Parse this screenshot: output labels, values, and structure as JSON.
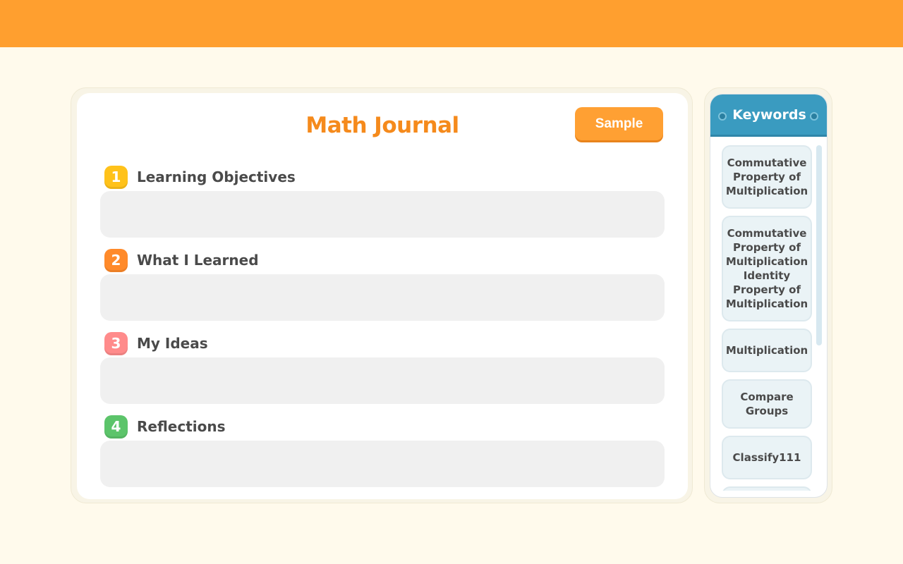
{
  "journal": {
    "title": "Math Journal",
    "sample_label": "Sample",
    "sections": [
      {
        "number": "1",
        "label": "Learning Objectives",
        "color": "#ffc21a",
        "value": ""
      },
      {
        "number": "2",
        "label": "What I Learned",
        "color": "#ff8a2a",
        "value": ""
      },
      {
        "number": "3",
        "label": "My Ideas",
        "color": "#ff8b8b",
        "value": ""
      },
      {
        "number": "4",
        "label": "Reflections",
        "color": "#5cc46a",
        "value": ""
      }
    ]
  },
  "keywords": {
    "title": "Keywords",
    "items": [
      "Commutative Property of Multiplication",
      "Commutative Property of Multiplication Identity Property of Multiplication",
      "Multiplication",
      "Compare Groups",
      "Classify111",
      ""
    ]
  },
  "colors": {
    "top_bar": "#ff9f2f",
    "accent": "#f58a1c",
    "keyword_header": "#3a9bc0"
  }
}
